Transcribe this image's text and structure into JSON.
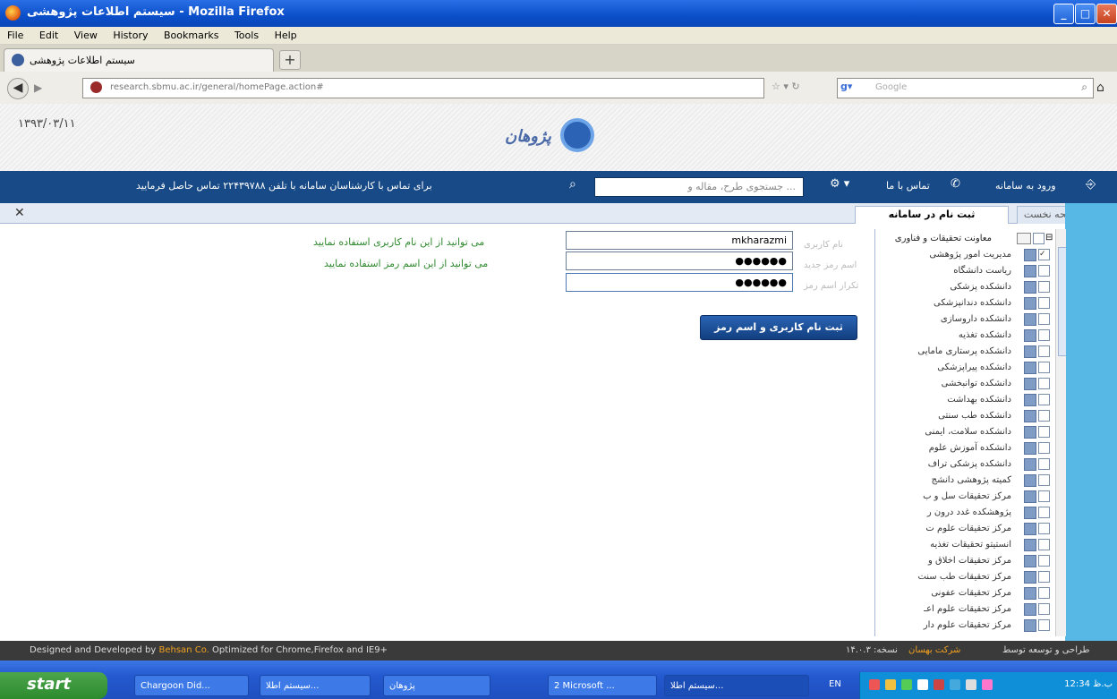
{
  "window": {
    "title": "سیستم اطلاعات پژوهشی - Mozilla Firefox",
    "controls": [
      "_",
      "□",
      "✕"
    ]
  },
  "menu": [
    "File",
    "Edit",
    "View",
    "History",
    "Bookmarks",
    "Tools",
    "Help"
  ],
  "browser": {
    "tab_title": "سیستم اطلاعات پژوهشی",
    "new_tab": "+",
    "url": "research.sbmu.ac.ir/general/homePage.action#",
    "search_engine": "Google",
    "search_placeholder": "Google"
  },
  "site": {
    "date": "۱۳۹۳/۰۳/۱۱",
    "logo_text": "پژوهان",
    "nav": {
      "login": "ورود به سامانه",
      "contact": "تماس با ما",
      "search_placeholder": "جستجوی طرح، مقاله و ...",
      "phone_notice": "برای تماس با کارشناسان سامانه با تلفن ۲۲۴۳۹۷۸۸ تماس حاصل فرمایید"
    },
    "tabs": {
      "home": "صفحه نخست",
      "register": "ثبت نام در سامانه"
    }
  },
  "tree": {
    "root": "معاونت تحقیقات و فناوری",
    "items": [
      "مدیریت امور پژوهشی",
      "ریاست دانشگاه",
      "دانشکده پزشکی",
      "دانشکده دندانپزشکی",
      "دانشکده داروسازی",
      "دانشکده تغذیه",
      "دانشکده پرستاری مامایی",
      "دانشکده پیراپزشکی",
      "دانشکده توانبخشی",
      "دانشکده بهداشت",
      "دانشکده طب سنتی",
      "دانشکده سلامت، ایمنی",
      "دانشکده آموزش علوم",
      "دانشکده پزشکی تراف",
      "کمیته پژوهشی دانشج",
      "مرکز تحقیقات سل و ب",
      "پژوهشکده غدد درون ر",
      "مرکز تحقیقات علوم ت",
      "انستیتو تحقیقات تغذیه",
      "مرکز تحقیقات اخلاق و",
      "مرکز تحقیقات طب سنت",
      "مرکز تحقیقات عفونی",
      "مرکز تحقیقات علوم اعـ",
      "مرکز تحقیقات علوم دار"
    ]
  },
  "form": {
    "username_label": "نام کاربری",
    "password_label": "اسم رمز جدید",
    "confirm_label": "تکرار اسم رمز",
    "username_value": "mkharazmi",
    "password_value": "●●●●●●",
    "confirm_value": "●●●●●●",
    "username_hint": "می توانید از این نام کاربری استفاده نمایید",
    "password_hint": "می توانید از این اسم رمز استفاده نمایید",
    "submit": "ثبت نام کاربری و اسم رمز"
  },
  "footer": {
    "left_prefix": "Designed and Developed by",
    "left_brand": "Behsan Co.",
    "left_suffix": "Optimized for Chrome,Firefox and IE9+",
    "right_text": "طراحی و توسعه توسط",
    "right_brand": "شرکت بهسان",
    "version": "نسخه: ۱۴.۰.۳"
  },
  "taskbar": {
    "start": "start",
    "tasks": [
      "Chargoon Did...",
      "سیستم اطلا...",
      "پژوهان",
      "2 Microsoft ...",
      "سیستم اطلا..."
    ],
    "lang": "EN",
    "clock": "12:34 ب.ظ"
  }
}
